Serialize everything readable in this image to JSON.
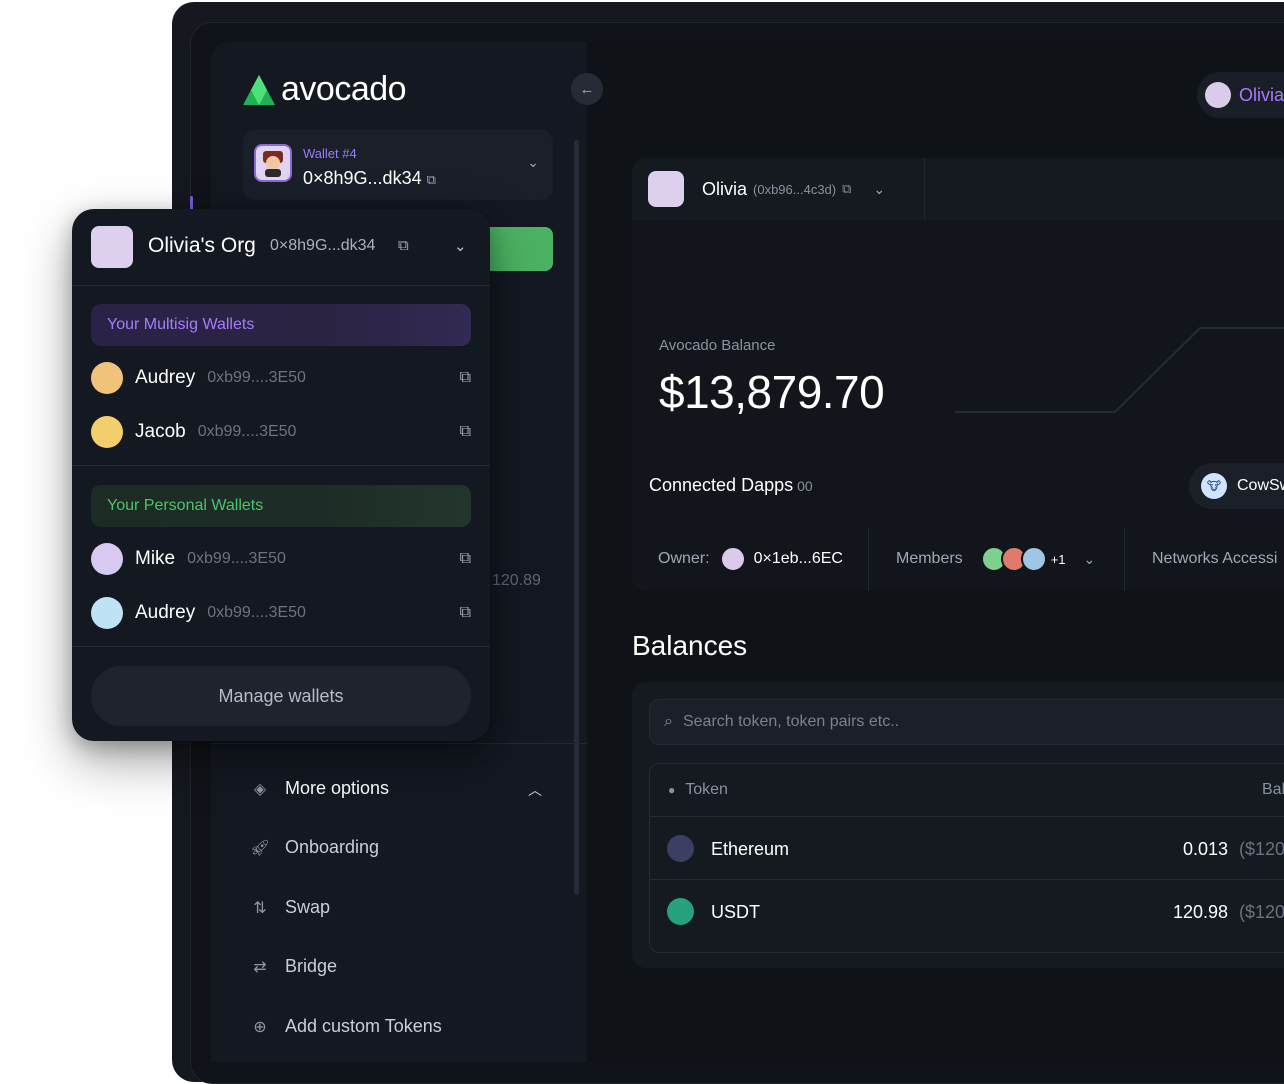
{
  "brand": {
    "name": "avocado",
    "accent_green": "#3fd36a",
    "accent_purple": "#a77bff"
  },
  "sidebar": {
    "wallet": {
      "label": "Wallet #4",
      "address": "0×8h9G...dk34"
    },
    "peek_amount": "120.89",
    "more_options": {
      "label": "More options",
      "icon": "layers-icon"
    },
    "menu": [
      {
        "label": "Onboarding",
        "icon": "rocket-icon"
      },
      {
        "label": "Swap",
        "icon": "swap-icon"
      },
      {
        "label": "Bridge",
        "icon": "bridge-arrows-icon"
      },
      {
        "label": "Add custom Tokens",
        "icon": "add-token-icon"
      }
    ]
  },
  "topbar": {
    "user": "Olivia"
  },
  "account": {
    "name": "Olivia",
    "address": "(0xb96...4c3d)"
  },
  "balance": {
    "label": "Avocado Balance",
    "value": "$13,879.70"
  },
  "dapps": {
    "label": "Connected Dapps",
    "count": "00",
    "first": "CowSw"
  },
  "owner_row": {
    "owner_label": "Owner:",
    "owner_address": "0×1eb...6EC",
    "members_label": "Members",
    "members_extra": "+1",
    "networks_label": "Networks Accessi"
  },
  "balances": {
    "title": "Balances",
    "search_placeholder": "Search token, token pairs etc..",
    "col_token": "Token",
    "col_balance": "Bal",
    "rows": [
      {
        "name": "Ethereum",
        "amount": "0.013",
        "usd": "($120",
        "icon_color": "#3b3f63"
      },
      {
        "name": "USDT",
        "amount": "120.98",
        "usd": "($120",
        "icon_color": "#26a17b"
      }
    ]
  },
  "dropdown": {
    "org_name": "Olivia's Org",
    "org_address": "0×8h9G...dk34",
    "multisig_title": "Your Multisig Wallets",
    "multisig": [
      {
        "name": "Audrey",
        "address": "0xb99....3E50"
      },
      {
        "name": "Jacob",
        "address": "0xb99....3E50"
      }
    ],
    "personal_title": "Your Personal Wallets",
    "personal": [
      {
        "name": "Mike",
        "address": "0xb99....3E50"
      },
      {
        "name": "Audrey",
        "address": "0xb99....3E50"
      }
    ],
    "manage_label": "Manage wallets"
  }
}
